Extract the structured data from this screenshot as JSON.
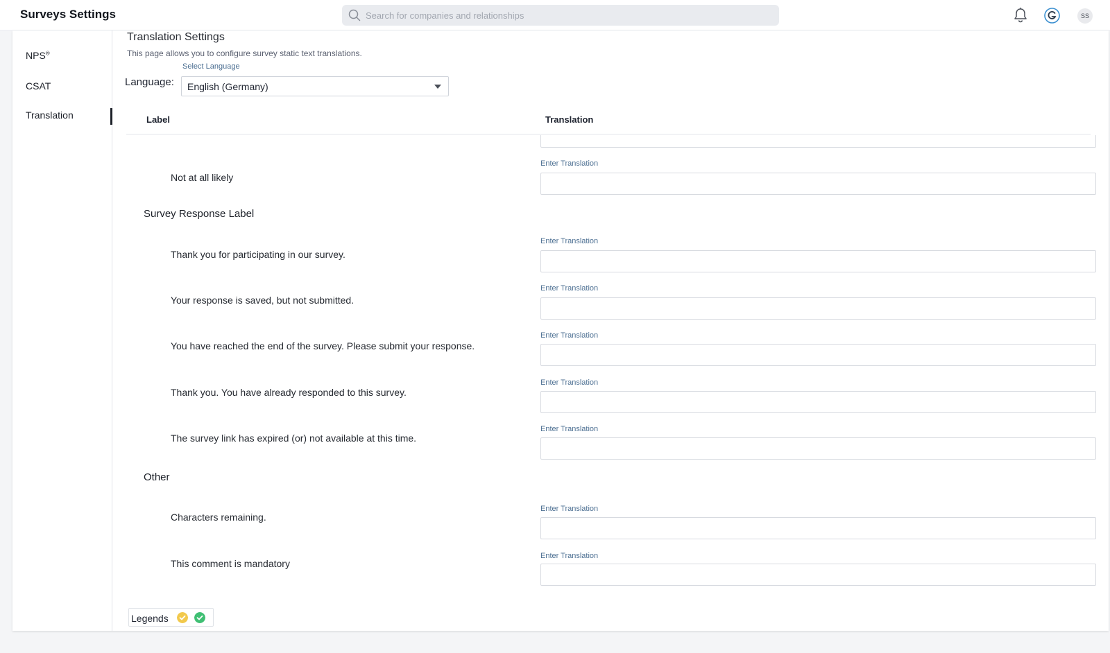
{
  "app": {
    "title": "Surveys Settings"
  },
  "search": {
    "placeholder": "Search for companies and relationships"
  },
  "header": {
    "avatar_initials": "SS"
  },
  "sidebar": {
    "items": [
      {
        "label": "NPS",
        "sup": "®"
      },
      {
        "label": "CSAT"
      },
      {
        "label": "Translation",
        "active": true
      }
    ]
  },
  "page": {
    "title": "Translation Settings",
    "description": "This page allows you to configure survey static text translations.",
    "language_label": "Language:",
    "select_label": "Select Language",
    "selected_language": "English (Germany)"
  },
  "table": {
    "col_label": "Label",
    "col_translation": "Translation",
    "field_label": "Enter Translation",
    "rows": [
      {
        "label": "Not at all likely",
        "value": ""
      }
    ],
    "sections": [
      {
        "title": "Survey Response Label",
        "rows": [
          {
            "label": "Thank you for participating in our survey.",
            "value": ""
          },
          {
            "label": "Your response is saved, but not submitted.",
            "value": ""
          },
          {
            "label": "You have reached the end of the survey. Please submit your response.",
            "value": ""
          },
          {
            "label": "Thank you. You have already responded to this survey.",
            "value": ""
          },
          {
            "label": "The survey link has expired (or) not available at this time.",
            "value": ""
          }
        ]
      },
      {
        "title": "Other",
        "rows": [
          {
            "label": "Characters remaining.",
            "value": ""
          },
          {
            "label": "This comment is mandatory",
            "value": ""
          }
        ]
      }
    ]
  },
  "legends": {
    "label": "Legends",
    "icons": [
      "pending-check-icon",
      "done-check-icon"
    ]
  },
  "colors": {
    "accent_link": "#4c6f92",
    "legend_yellow": "#f2c94c",
    "legend_green": "#3fbf73"
  }
}
